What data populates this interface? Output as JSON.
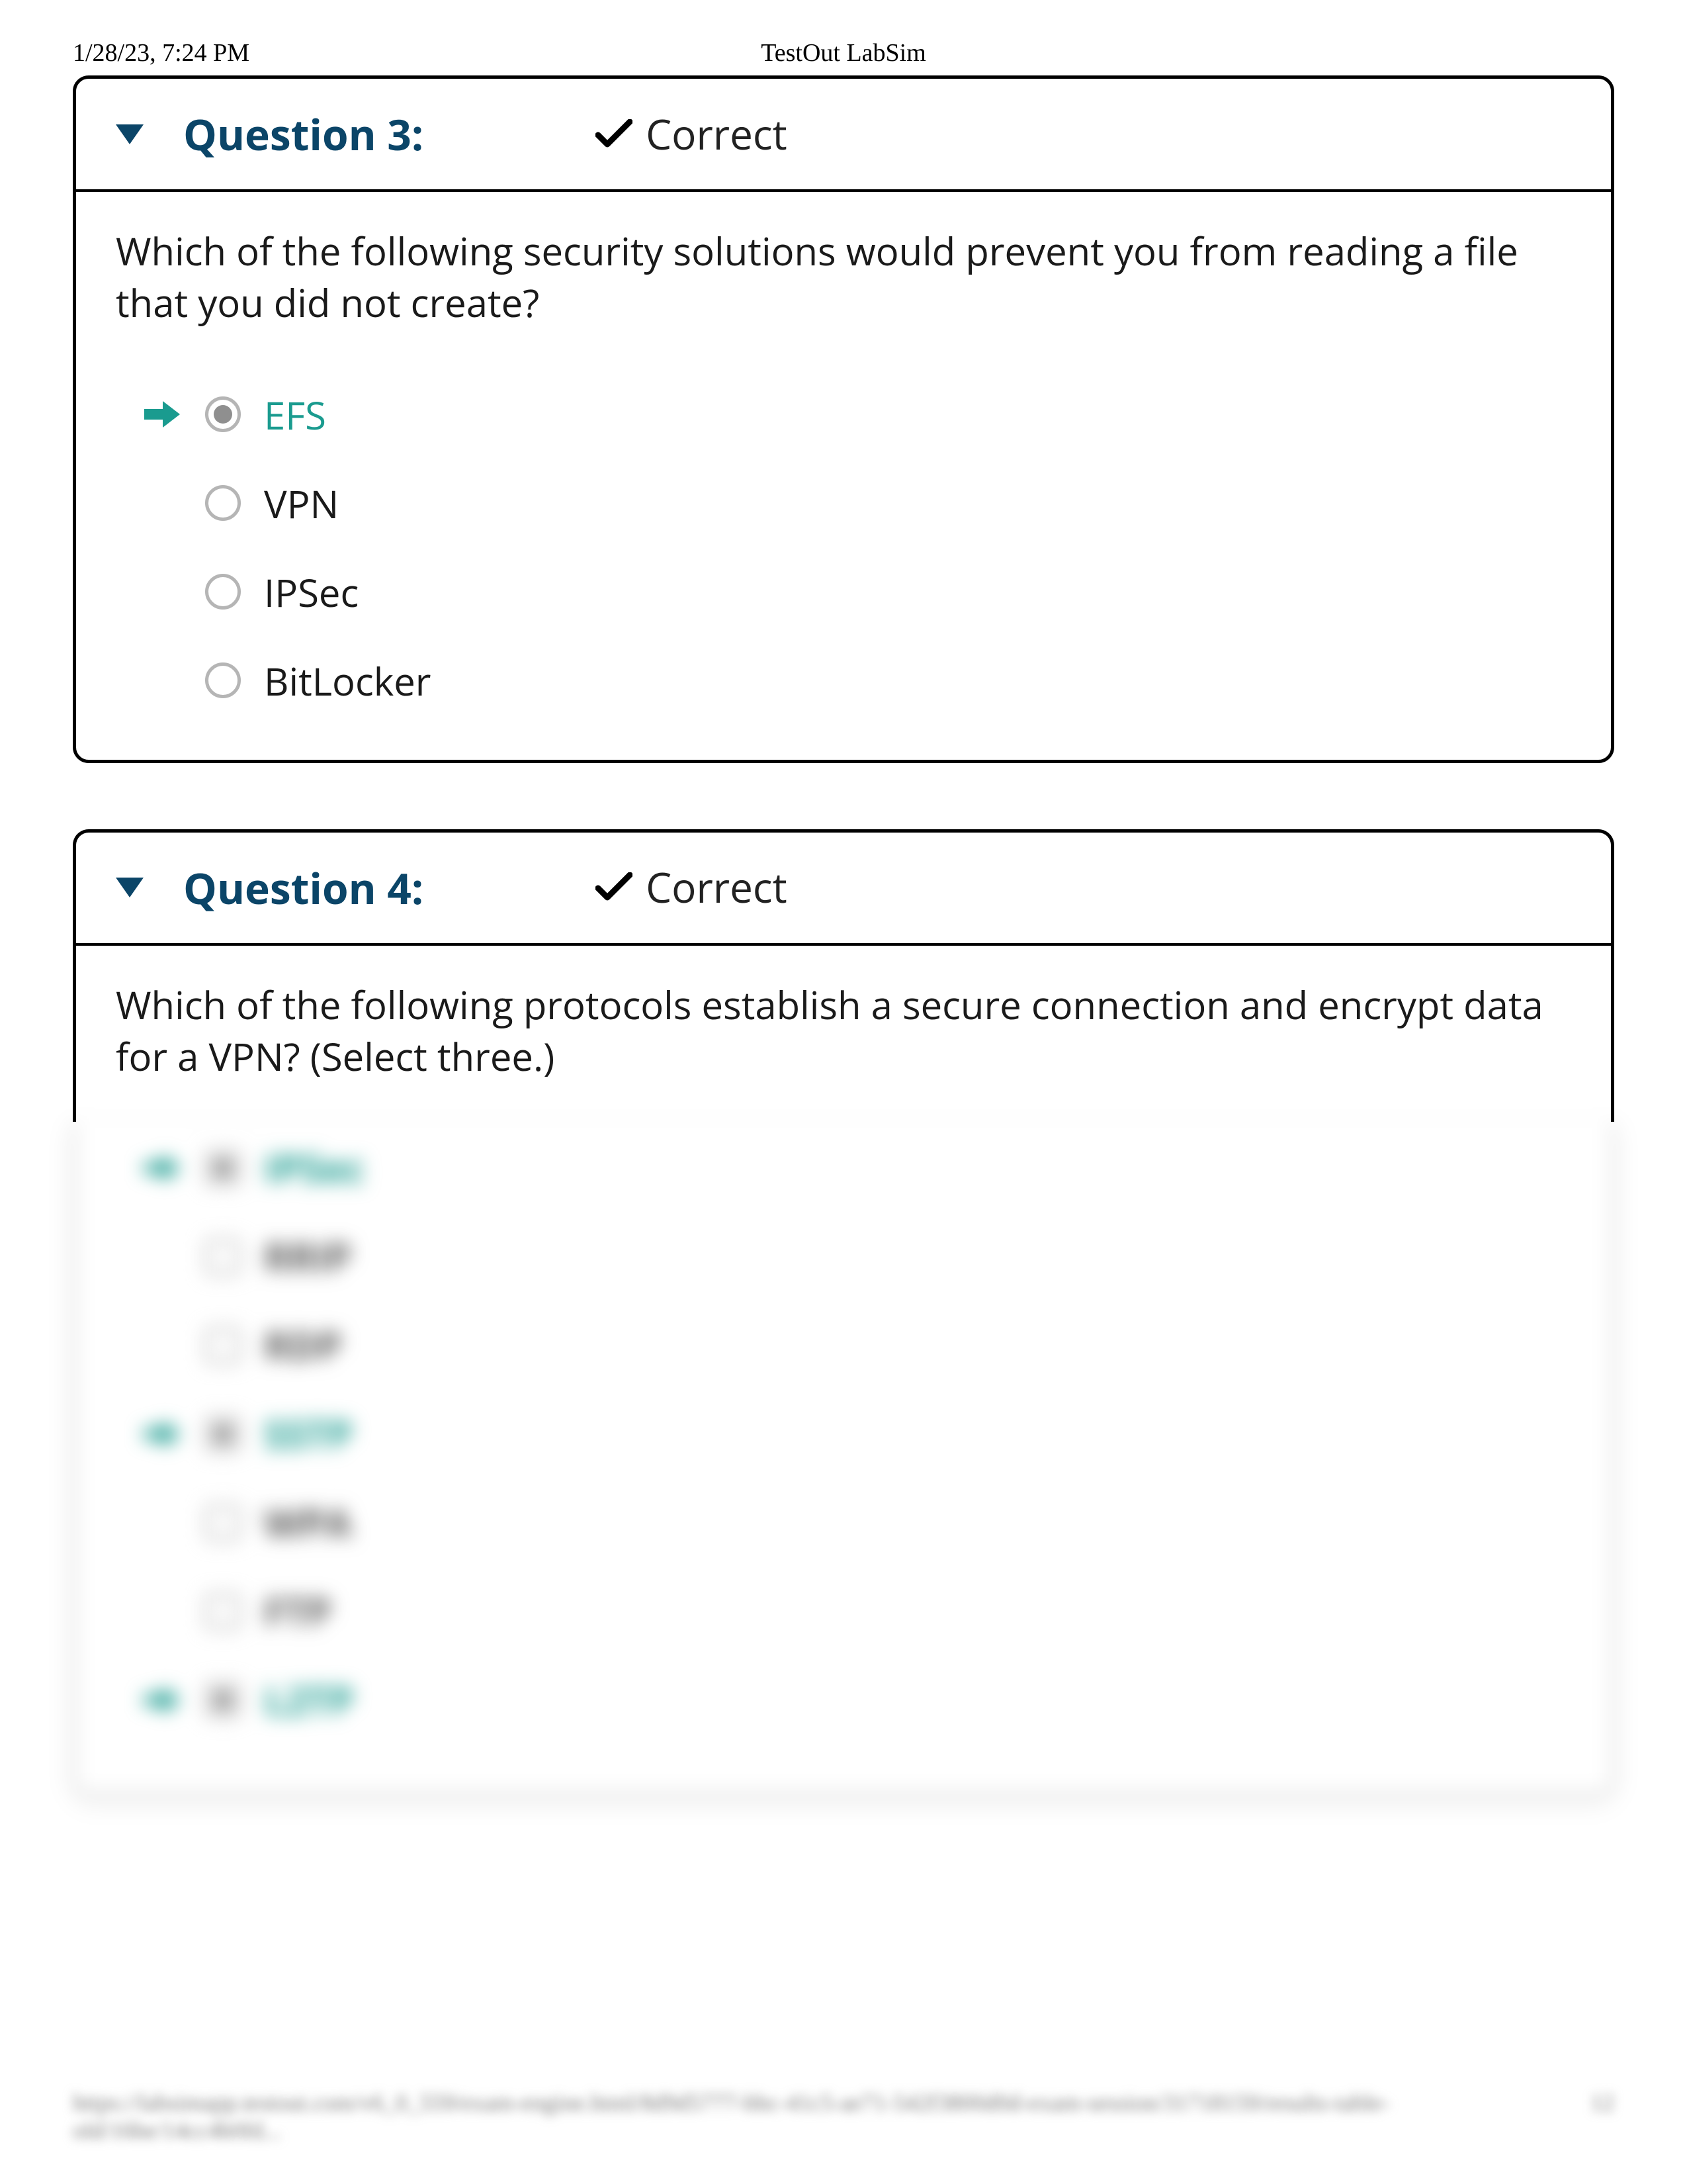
{
  "header": {
    "timestamp": "1/28/23, 7:24 PM",
    "app_title": "TestOut LabSim"
  },
  "question3": {
    "title": "Question 3:",
    "status": "Correct",
    "prompt": "Which of the following security solutions would prevent you from reading a file that you did not create?",
    "options": [
      {
        "label": "EFS",
        "selected": true,
        "correct": true
      },
      {
        "label": "VPN",
        "selected": false,
        "correct": false
      },
      {
        "label": "IPSec",
        "selected": false,
        "correct": false
      },
      {
        "label": "BitLocker",
        "selected": false,
        "correct": false
      }
    ]
  },
  "question4": {
    "title": "Question 4:",
    "status": "Correct",
    "prompt": "Which of the following protocols establish a secure connection and encrypt data for a VPN? (Select three.)",
    "options": [
      {
        "label": "IPSec",
        "selected": true,
        "correct": true
      },
      {
        "label": "RRIP",
        "selected": false,
        "correct": false
      },
      {
        "label": "RDP",
        "selected": false,
        "correct": false
      },
      {
        "label": "SSTP",
        "selected": true,
        "correct": true
      },
      {
        "label": "WPA",
        "selected": false,
        "correct": false
      },
      {
        "label": "FTP",
        "selected": false,
        "correct": false
      },
      {
        "label": "L2TP",
        "selected": true,
        "correct": true
      }
    ]
  },
  "footer": {
    "url_fragment": "https://labsimapp.testout.com/v6_0_559/exam-engine.html/8d9d5777-bbc-41c5-ae71-542f3800d0d-exam-session/31718159/results-table-old/16be/14cc4b0fd...",
    "page_number": "12"
  }
}
